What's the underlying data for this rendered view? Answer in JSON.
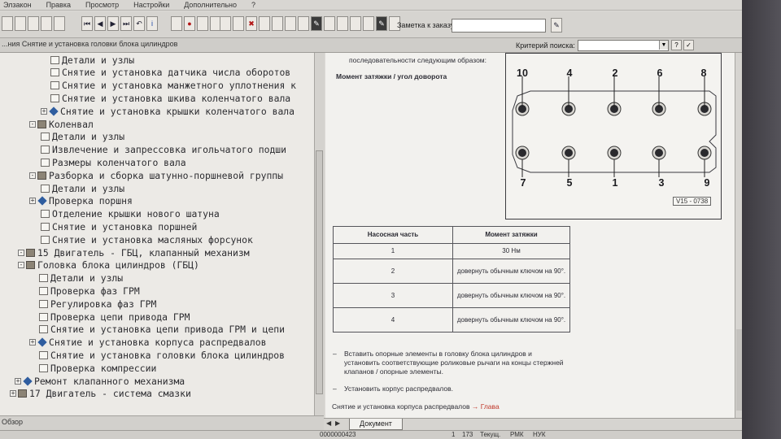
{
  "menu": [
    "Элзакон",
    "Правка",
    "Просмотр",
    "Настройки",
    "Дополнительно",
    "?"
  ],
  "toolbar": {
    "note_label": "Заметка к заказу:",
    "note_value": ""
  },
  "address": {
    "path": "...ния Снятие и установка головки блока цилиндров",
    "criteria_label": "Критерий поиска:",
    "criteria_value": ""
  },
  "tree": [
    {
      "label": "Детали и узлы",
      "icon": "page"
    },
    {
      "label": "Снятие и установка датчика числа оборотов",
      "icon": "page"
    },
    {
      "label": "Снятие и установка манжетного уплотнения к",
      "icon": "page"
    },
    {
      "label": "Снятие и установка шкива коленчатого вала",
      "icon": "page"
    },
    {
      "label": "Снятие и установка крышки коленчатого вала",
      "icon": "diamond",
      "exp": "+"
    },
    {
      "label": "Коленвал",
      "icon": "book",
      "exp": "-"
    },
    {
      "label": "Детали и узлы",
      "icon": "page"
    },
    {
      "label": "Извлечение и запрессовка игольчатого подши",
      "icon": "page"
    },
    {
      "label": "Размеры коленчатого вала",
      "icon": "page"
    },
    {
      "label": "Разборка и сборка шатунно-поршневой группы",
      "icon": "book",
      "exp": "-"
    },
    {
      "label": "Детали и узлы",
      "icon": "page"
    },
    {
      "label": "Проверка поршня",
      "icon": "diamond",
      "exp": "+"
    },
    {
      "label": "Отделение крышки нового шатуна",
      "icon": "page"
    },
    {
      "label": "Снятие и установка поршней",
      "icon": "page"
    },
    {
      "label": "Снятие и установка масляных форсунок",
      "icon": "page"
    },
    {
      "label": "15 Двигатель - ГБЦ, клапанный механизм",
      "icon": "book",
      "exp": "-"
    },
    {
      "label": "Головка блока цилиндров (ГБЦ)",
      "icon": "book",
      "exp": "-"
    },
    {
      "label": "Детали и узлы",
      "icon": "page"
    },
    {
      "label": "Проверка фаз ГРМ",
      "icon": "page"
    },
    {
      "label": "Регулировка фаз ГРМ",
      "icon": "page"
    },
    {
      "label": "Проверка цепи привода ГРМ",
      "icon": "page"
    },
    {
      "label": "Снятие и установка цепи привода ГРМ и цепи",
      "icon": "page"
    },
    {
      "label": "Снятие и установка корпуса распредвалов",
      "icon": "diamond",
      "exp": "+"
    },
    {
      "label": "Снятие и установка головки блока цилиндров",
      "icon": "page"
    },
    {
      "label": "Проверка компрессии",
      "icon": "page"
    },
    {
      "label": "Ремонт клапанного механизма",
      "icon": "diamond",
      "exp": "+"
    },
    {
      "label": "17 Двигатель - система смазки",
      "icon": "book",
      "exp": "+"
    }
  ],
  "left_tab": "Обзор",
  "doc": {
    "intro": "последовательности следующим образом:",
    "moment_heading": "Момент затяжки / угол доворота",
    "diagram": {
      "top_numbers": [
        "10",
        "4",
        "2",
        "6",
        "8"
      ],
      "bottom_numbers": [
        "7",
        "5",
        "1",
        "3",
        "9"
      ],
      "code": "V15 - 0738"
    },
    "table": {
      "headers": [
        "Насосная часть",
        "Момент затяжки"
      ],
      "rows": [
        [
          "1",
          "30 Нм"
        ],
        [
          "2",
          "довернуть обычным ключом на 90°."
        ],
        [
          "3",
          "довернуть обычным ключом на 90°."
        ],
        [
          "4",
          "довернуть обычным ключом на 90°."
        ]
      ]
    },
    "steps": [
      "Вставить опорные элементы в головку блока цилиндров и установить соответствующие роликовые рычаги на концы стержней клапанов / опорные элементы.",
      "Установить корпус распредвалов."
    ],
    "footer_text": "Снятие и установка корпуса распредвалов",
    "footer_link": "→ Глава"
  },
  "doc_tab": "Документ",
  "status": {
    "id": "0000000423",
    "page": "1",
    "total": "173",
    "mode1": "Текущ.",
    "mode2": "РМК",
    "mode3": "НУК"
  }
}
